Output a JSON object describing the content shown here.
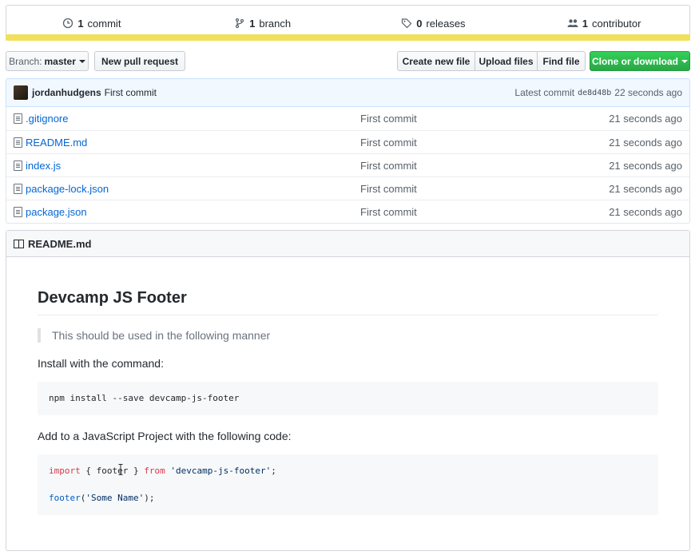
{
  "summary": {
    "commits": {
      "count": "1",
      "label": "commit"
    },
    "branches": {
      "count": "1",
      "label": "branch"
    },
    "releases": {
      "count": "0",
      "label": "releases"
    },
    "contributors": {
      "count": "1",
      "label": "contributor"
    },
    "language_bar_color": "#f1e05a"
  },
  "toolbar": {
    "branch_prefix": "Branch:",
    "branch_name": "master",
    "new_pr": "New pull request",
    "create_file": "Create new file",
    "upload_files": "Upload files",
    "find_file": "Find file",
    "clone": "Clone or download"
  },
  "commit": {
    "author": "jordanhudgens",
    "message": "First commit",
    "latest_label": "Latest commit",
    "sha": "de8d48b",
    "age": "22 seconds ago"
  },
  "files": [
    {
      "name": ".gitignore",
      "message": "First commit",
      "age": "21 seconds ago"
    },
    {
      "name": "README.md",
      "message": "First commit",
      "age": "21 seconds ago"
    },
    {
      "name": "index.js",
      "message": "First commit",
      "age": "21 seconds ago"
    },
    {
      "name": "package-lock.json",
      "message": "First commit",
      "age": "21 seconds ago"
    },
    {
      "name": "package.json",
      "message": "First commit",
      "age": "21 seconds ago"
    }
  ],
  "readme": {
    "header": "README.md",
    "title": "Devcamp JS Footer",
    "quote": "This should be used in the following manner",
    "install_text": "Install with the command:",
    "install_cmd": "npm install --save devcamp-js-footer",
    "add_text": "Add to a JavaScript Project with the following code:",
    "code": {
      "import_kw": "import",
      "import_braces_open": " { ",
      "import_name": "footer",
      "import_braces_close": " } ",
      "from_kw": "from",
      "import_space": " ",
      "import_module": "'devcamp-js-footer'",
      "import_semi": ";",
      "call_fn": "footer",
      "call_open": "(",
      "call_arg": "'Some Name'",
      "call_close": ");"
    }
  }
}
